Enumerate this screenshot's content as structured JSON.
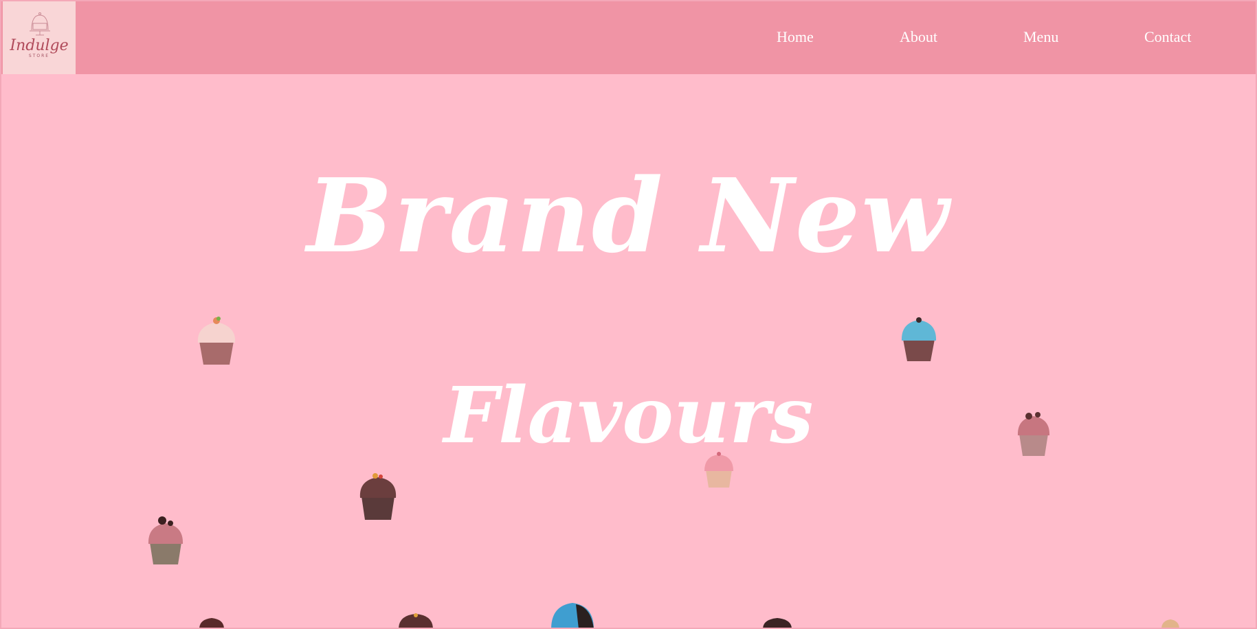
{
  "brand": {
    "logo_text": "Indulge",
    "logo_subtext": "STORE"
  },
  "nav": {
    "items": [
      {
        "label": "Home"
      },
      {
        "label": "About"
      },
      {
        "label": "Menu"
      },
      {
        "label": "Contact"
      }
    ]
  },
  "hero": {
    "line1": "Brand New",
    "line2": "Flavours"
  },
  "colors": {
    "header_bg": "#f094a5",
    "page_bg": "#ffbccb",
    "logo_bg": "#f9d6d7",
    "hero_text": "#ffffff"
  },
  "decorations": {
    "icons": [
      "cupcake-icon"
    ]
  }
}
